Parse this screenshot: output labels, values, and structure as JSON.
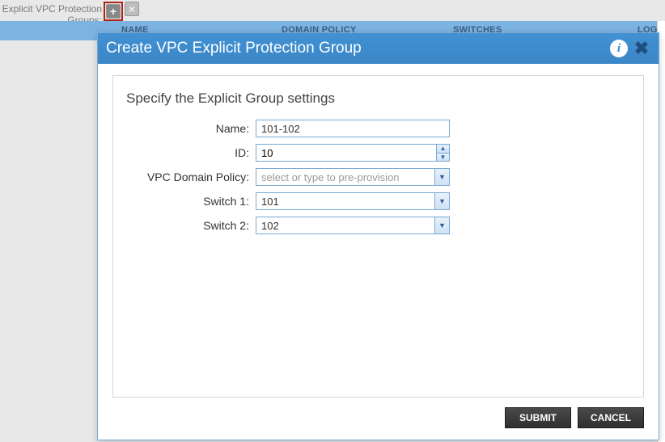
{
  "page": {
    "label": "Explicit VPC Protection Groups:"
  },
  "columns": {
    "name": "NAME",
    "domain_policy": "DOMAIN POLICY",
    "switches": "SWITCHES",
    "logical": "LOGIC"
  },
  "dialog": {
    "title": "Create VPC Explicit Protection Group",
    "section_heading": "Specify the Explicit Group settings",
    "labels": {
      "name": "Name:",
      "id": "ID:",
      "vpc_domain_policy": "VPC Domain Policy:",
      "switch1": "Switch 1:",
      "switch2": "Switch 2:"
    },
    "values": {
      "name": "101-102",
      "id": "10",
      "vpc_domain_policy": "",
      "vpc_domain_policy_placeholder": "select or type to pre-provision",
      "switch1": "101",
      "switch2": "102"
    },
    "buttons": {
      "submit": "SUBMIT",
      "cancel": "CANCEL"
    }
  }
}
